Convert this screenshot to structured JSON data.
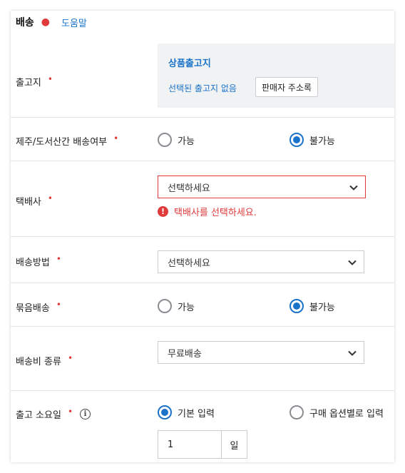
{
  "header": {
    "title": "배송",
    "help": "도움말"
  },
  "origin": {
    "label": "출고지",
    "box_title": "상품출고지",
    "none_text": "선택된 출고지 없음",
    "address_button": "판매자 주소록"
  },
  "jeju": {
    "label": "제주/도서산간 배송여부",
    "options": [
      "가능",
      "불가능"
    ],
    "selected": "불가능"
  },
  "courier": {
    "label": "택배사",
    "placeholder": "선택하세요",
    "error": "택배사를 선택하세요."
  },
  "method": {
    "label": "배송방법",
    "value": "선택하세요"
  },
  "bundle": {
    "label": "묶음배송",
    "options": [
      "가능",
      "불가능"
    ],
    "selected": "불가능"
  },
  "fee_type": {
    "label": "배송비 종류",
    "value": "무료배송"
  },
  "lead_time": {
    "label": "출고 소요일",
    "options": [
      "기본 입력",
      "구매 옵션별로 입력"
    ],
    "selected": "기본 입력",
    "days_value": "1",
    "days_unit": "일"
  },
  "colors": {
    "accent": "#1a73c9",
    "required": "#e03a3a",
    "error": "#e03a3a"
  },
  "icons": [
    "chevron-down-icon",
    "error-icon",
    "info-icon"
  ]
}
